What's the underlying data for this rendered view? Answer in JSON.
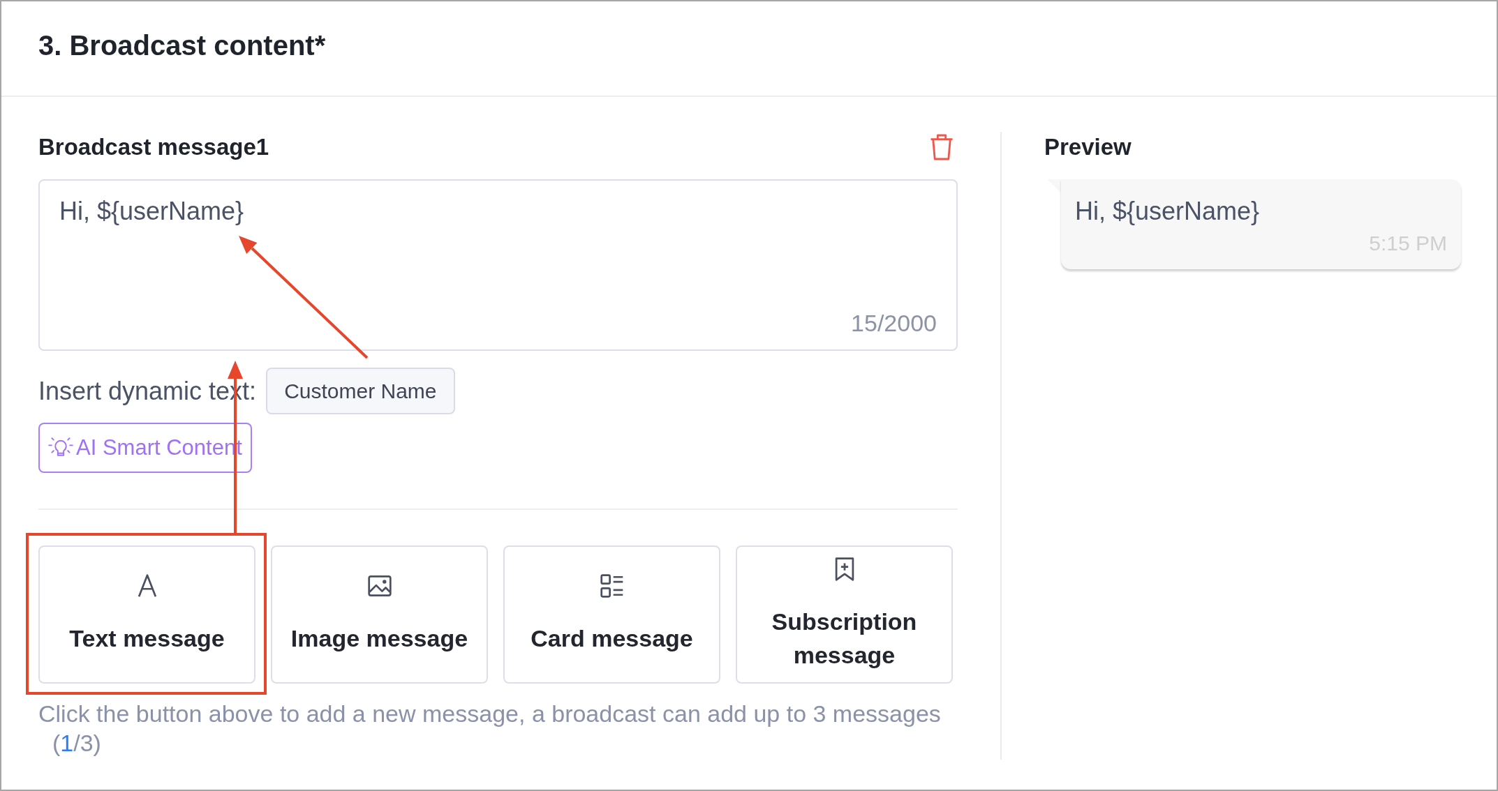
{
  "header": {
    "title": "3. Broadcast content*"
  },
  "editor": {
    "title": "Broadcast message1",
    "message": {
      "value": "Hi, ${userName}",
      "counter": "15/2000"
    },
    "dynamic_text": {
      "label": "Insert dynamic text:",
      "chips": [
        {
          "label": "Customer Name",
          "arrow": true
        }
      ]
    },
    "ai_button": {
      "label": "AI Smart Content"
    },
    "message_types": [
      {
        "kind": "text",
        "label": "Text message",
        "highlighted": true,
        "arrow": true
      },
      {
        "kind": "image",
        "label": "Image message",
        "highlighted": false,
        "arrow": false
      },
      {
        "kind": "card",
        "label": "Card message",
        "highlighted": false,
        "arrow": false
      },
      {
        "kind": "subscription",
        "label": "Subscription message",
        "highlighted": false,
        "arrow": false
      }
    ],
    "hint": {
      "text": "Click the button above to add a new message, a broadcast can add up to 3 messages",
      "count": [
        {
          "text": "(",
          "current": false
        },
        {
          "text": "1",
          "current": true
        },
        {
          "text": "/3)",
          "current": false
        }
      ]
    }
  },
  "preview": {
    "title": "Preview",
    "bubble": {
      "text": "Hi, ${userName}",
      "time": "5:15 PM"
    }
  }
}
